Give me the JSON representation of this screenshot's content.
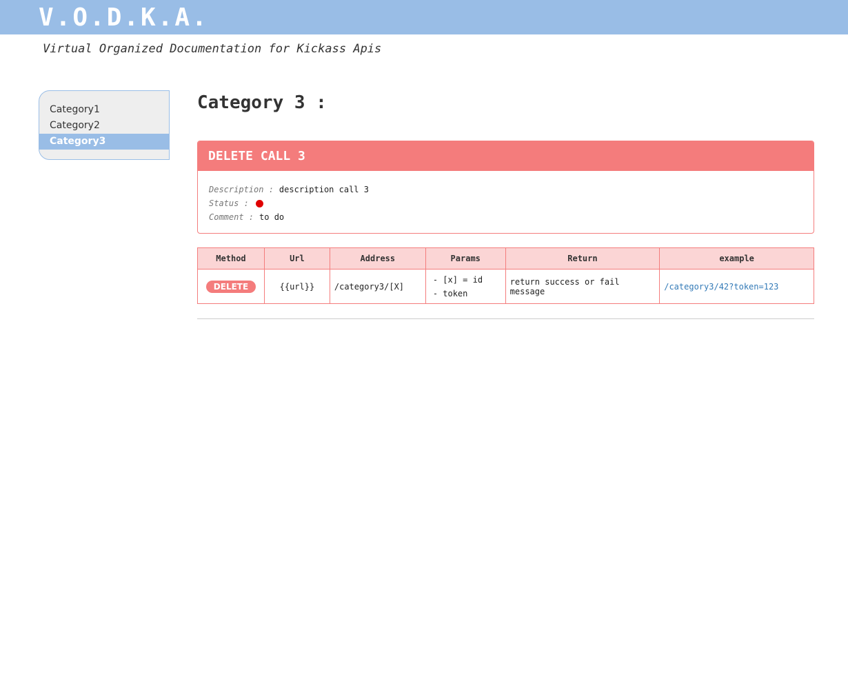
{
  "header": {
    "logo": "V.O.D.K.A.",
    "tagline": "Virtual Organized Documentation for Kickass Apis"
  },
  "sidebar": {
    "items": [
      {
        "label": "Category1",
        "active": false
      },
      {
        "label": "Category2",
        "active": false
      },
      {
        "label": "Category3",
        "active": true
      }
    ]
  },
  "main": {
    "title": "Category 3 :",
    "call": {
      "name": "DELETE CALL 3",
      "description_label": "Description :",
      "description": "description call 3",
      "status_label": "Status :",
      "status_color": "#e00000",
      "comment_label": "Comment :",
      "comment": "to do"
    },
    "table": {
      "headers": [
        "Method",
        "Url",
        "Address",
        "Params",
        "Return",
        "example"
      ],
      "row": {
        "method": "DELETE",
        "url": "{{url}}",
        "address": "/category3/[X]",
        "params": [
          "- [x] = id",
          "- token"
        ],
        "return": "return success or fail message",
        "example": "/category3/42?token=123"
      }
    }
  },
  "colors": {
    "header_blue": "#99bde6",
    "delete_red": "#f47c7c",
    "table_header_pink": "#fbd5d5",
    "link_blue": "#337ab7"
  }
}
